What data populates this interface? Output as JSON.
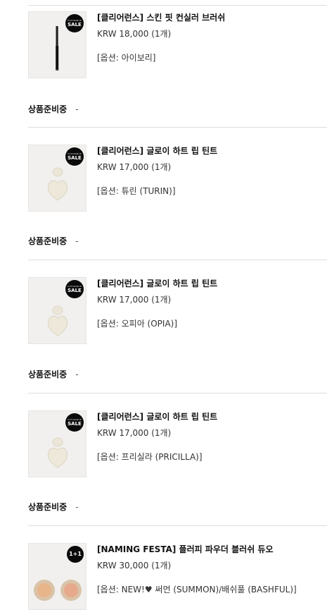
{
  "items": [
    {
      "name": "[클리어런스] 스킨 핏 컨실러 브러쉬",
      "price": "KRW 18,000 (1개)",
      "option": "[옵션: 아이보리]",
      "badge": {
        "small": "CLEARANCE",
        "big": "SALE"
      },
      "status_label": "상품준비중",
      "status_value": "-"
    },
    {
      "name": "[클리어런스] 글로이 하트 립 틴트",
      "price": "KRW 17,000 (1개)",
      "option": "[옵션: 튜린 (TURIN)]",
      "badge": {
        "small": "CLEARANCE",
        "big": "SALE"
      },
      "status_label": "상품준비중",
      "status_value": "-"
    },
    {
      "name": "[클리어런스] 글로이 하트 립 틴트",
      "price": "KRW 17,000 (1개)",
      "option": "[옵션: 오피아 (OPIA)]",
      "badge": {
        "small": "CLEARANCE",
        "big": "SALE"
      },
      "status_label": "상품준비중",
      "status_value": "-"
    },
    {
      "name": "[클리어런스] 글로이 하트 립 틴트",
      "price": "KRW 17,000 (1개)",
      "option": "[옵션: 프리실라 (PRICILLA)]",
      "badge": {
        "small": "CLEARANCE",
        "big": "SALE"
      },
      "status_label": "상품준비중",
      "status_value": "-"
    },
    {
      "name": "[NAMING FESTA] 플러피 파우더 블러쉬 듀오",
      "price": "KRW 30,000 (1개)",
      "option": "[옵션: NEW!♥ 써먼 (SUMMON)/배쉬풀 (BASHFUL)]",
      "badge": {
        "plus": "1+1"
      }
    }
  ],
  "colors": {
    "badge_bg": "#0a0a0a",
    "divider": "#dddddd",
    "thumb_bg": "#f1f0ee"
  }
}
